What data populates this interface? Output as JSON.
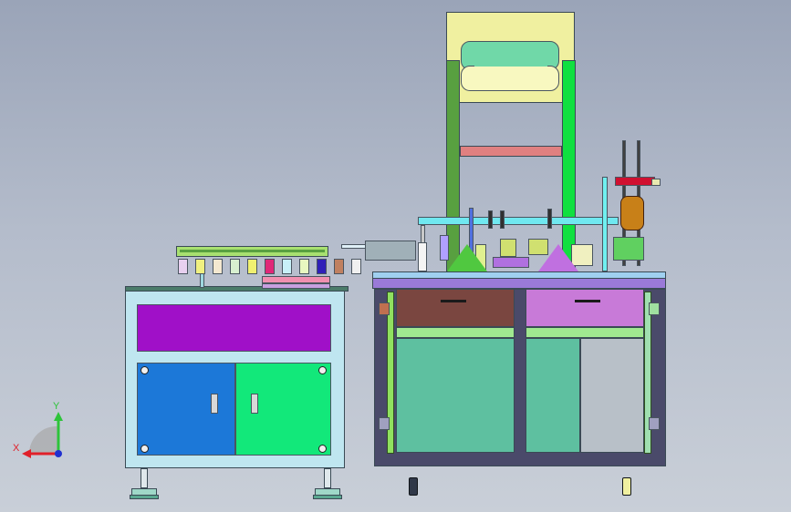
{
  "viewport": {
    "background_top": "#9aa4b8",
    "background_bottom": "#c9cfd8"
  },
  "axis_triad": {
    "x_label": "X",
    "y_label": "Y",
    "x_color": "#e0202a",
    "y_color": "#2ec43a",
    "origin_color": "#2030d0"
  },
  "colors": {
    "left_cabinet_frame": "#bfe6f0",
    "purple_drawer": "#a010c8",
    "blue_door": "#1c78d8",
    "green_door": "#12e87a",
    "right_cabinet_frame": "#4a4a6a",
    "top_plate": "#9a7ad8",
    "brown_drawer": "#7a4640",
    "pink_drawer": "#c87ad8",
    "tall_frame": "#10d030",
    "header_box": "#f0f0a0",
    "green_panel": "#5ec0a0"
  },
  "icons": [
    "axis-triad-icon",
    "drawer-handle-icon",
    "leveling-foot-icon",
    "hinge-icon",
    "screw-icon"
  ]
}
